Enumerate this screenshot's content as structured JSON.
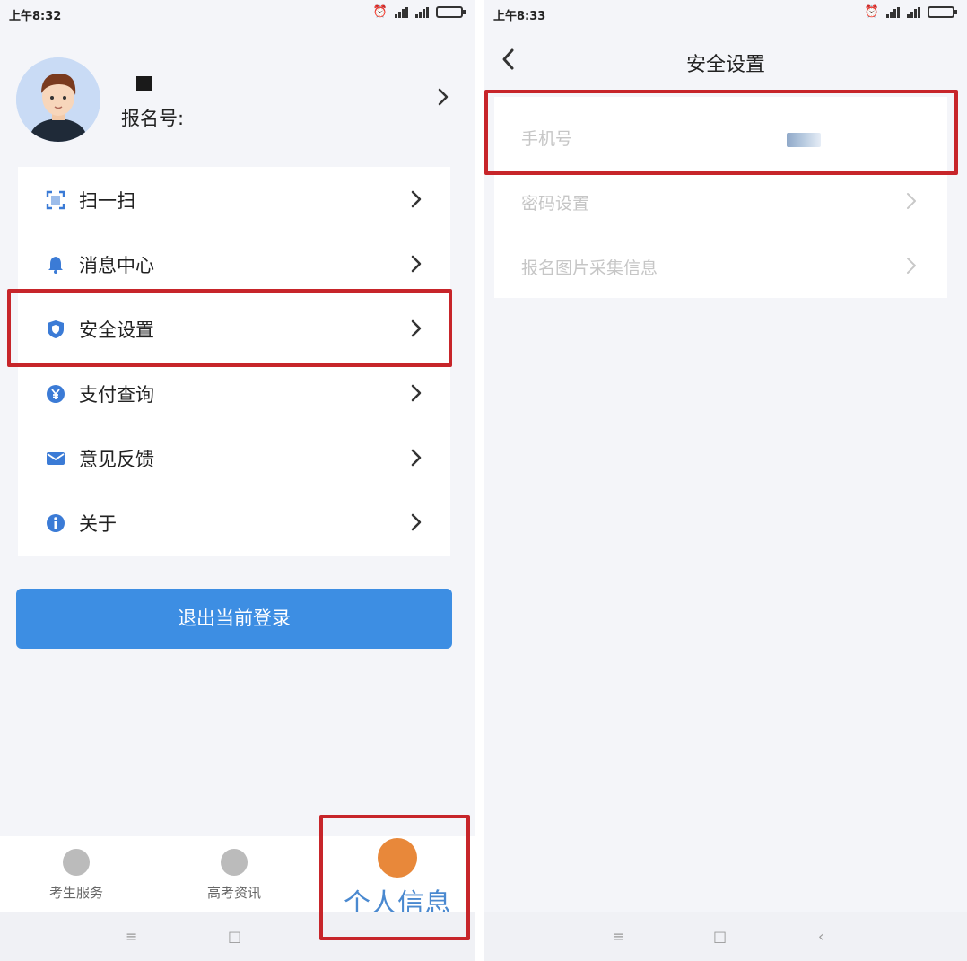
{
  "left_screen": {
    "status_bar": {
      "time": "上午8:32"
    },
    "profile": {
      "reg_label": "报名号:"
    },
    "menu": [
      {
        "label": "扫一扫",
        "icon": "scan-icon"
      },
      {
        "label": "消息中心",
        "icon": "bell-icon"
      },
      {
        "label": "安全设置",
        "icon": "shield-icon"
      },
      {
        "label": "支付查询",
        "icon": "yen-icon"
      },
      {
        "label": "意见反馈",
        "icon": "mail-icon"
      },
      {
        "label": "关于",
        "icon": "info-icon"
      }
    ],
    "logout_label": "退出当前登录",
    "tabs": [
      {
        "label": "考生服务",
        "icon": "heart-icon"
      },
      {
        "label": "高考资讯",
        "icon": "news-icon"
      },
      {
        "label": "个人信息",
        "icon": "profile-icon",
        "active": true
      }
    ]
  },
  "right_screen": {
    "status_bar": {
      "time": "上午8:33"
    },
    "title": "安全设置",
    "items": [
      {
        "label": "手机号"
      },
      {
        "label": "密码设置"
      },
      {
        "label": "报名图片采集信息"
      }
    ]
  },
  "colors": {
    "accent": "#3d8ee3",
    "highlight": "#c7252a",
    "icon_blue": "#3b7bd6",
    "active_tab": "#4a89d0"
  }
}
